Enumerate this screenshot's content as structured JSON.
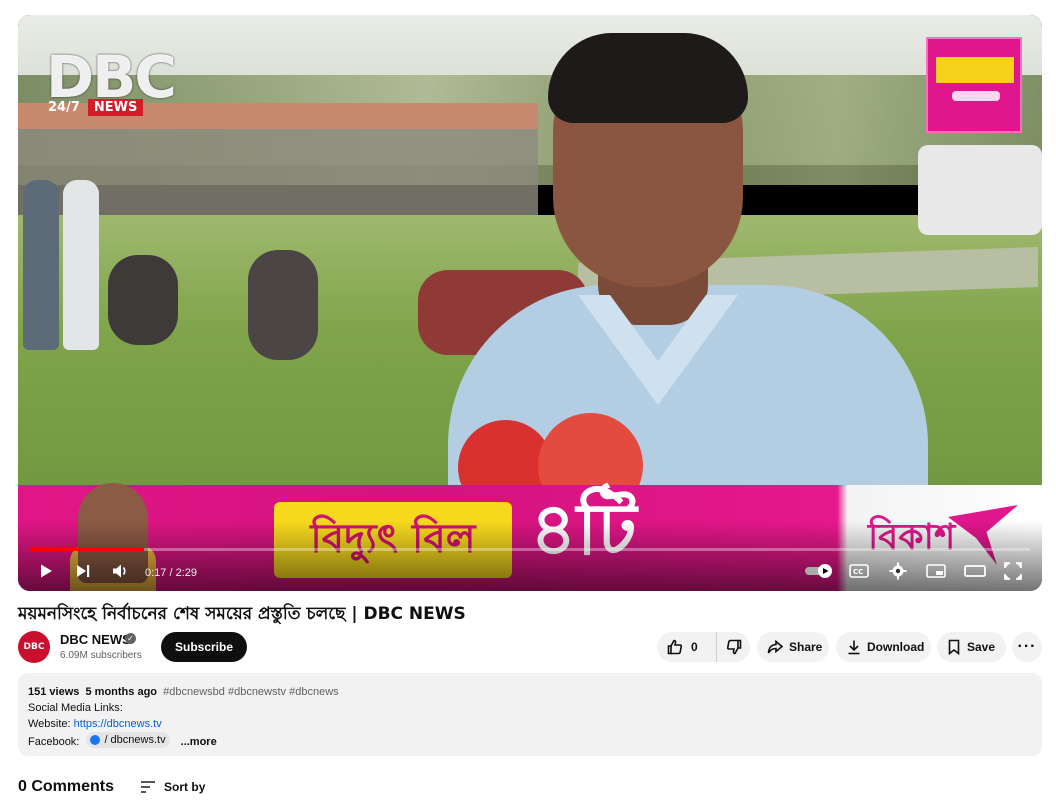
{
  "player": {
    "overlay_logo": "DBC",
    "overlay_logo_sub": "24/7",
    "overlay_logo_news": "NEWS",
    "ad_text": "বিদ্যুৎ বিল",
    "ad_number": "৪টি",
    "ad_brand": "বিকাশ",
    "current_time": "0:17",
    "duration": "2:29",
    "time_display": "0:17 / 2:29",
    "progress_fraction": 0.114
  },
  "video": {
    "title": "ময়মনসিংহে নির্বাচনের শেষ সময়ের প্রস্তুতি চলছে | DBC NEWS"
  },
  "channel": {
    "avatar_text": "DBC",
    "name": "DBC NEWS",
    "verified_mark": "✓",
    "subscribers": "6.09M subscribers",
    "subscribe_label": "Subscribe"
  },
  "actions": {
    "like_count": "0",
    "share_label": "Share",
    "download_label": "Download",
    "save_label": "Save",
    "more_label": "···"
  },
  "description": {
    "views": "151 views",
    "age": "5 months ago",
    "hashtags": "#dbcnewsbd #dbcnewstv #dbcnews",
    "line_social": "Social Media Links:",
    "website_label": "Website:",
    "website_url": "https://dbcnews.tv",
    "facebook_label": "Facebook:",
    "facebook_handle": "/ dbcnews.tv",
    "more_label": "...more"
  },
  "comments": {
    "count_label": "0 Comments",
    "sort_label": "Sort by"
  },
  "colors": {
    "progress": "#ff0000",
    "brand_red": "#c8102e",
    "ad_magenta": "#e0168c",
    "link": "#065fd4"
  }
}
